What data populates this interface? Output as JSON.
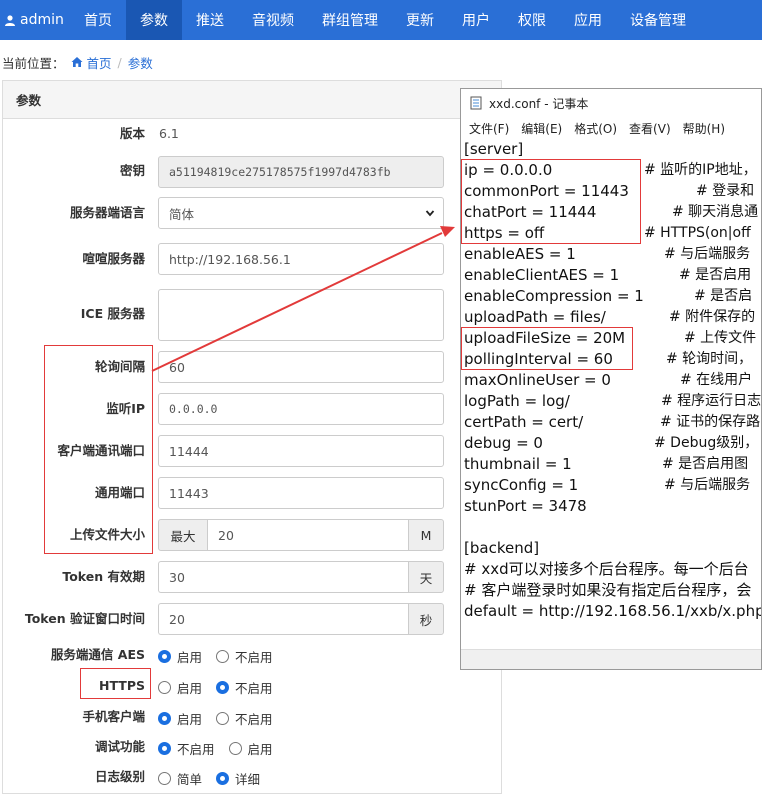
{
  "nav": {
    "brand": "admin",
    "items": [
      "首页",
      "参数",
      "推送",
      "音视频",
      "群组管理",
      "更新",
      "用户",
      "权限",
      "应用",
      "设备管理"
    ]
  },
  "breadcrumb": {
    "prefix": "当前位置：",
    "home": "首页",
    "sep": "/",
    "current": "参数"
  },
  "panel": {
    "title": "参数",
    "version_label": "版本",
    "version_value": "6.1",
    "key_label": "密钥",
    "key_value": "a51194819ce275178575f1997d4783fb",
    "lang_label": "服务器端语言",
    "lang_value": "简体",
    "xuan_label": "喧喧服务器",
    "xuan_value": "http://192.168.56.1",
    "ice_label": "ICE 服务器",
    "ice_value": "",
    "poll_label": "轮询间隔",
    "poll_value": "60",
    "listen_label": "监听IP",
    "listen_value": "0.0.0.0",
    "client_port_label": "客户端通讯端口",
    "client_port_value": "11444",
    "common_port_label": "通用端口",
    "common_port_value": "11443",
    "upload_label": "上传文件大小",
    "upload_prefix": "最大",
    "upload_value": "20",
    "upload_unit": "M",
    "token_label": "Token 有效期",
    "token_value": "30",
    "token_unit": "天",
    "tokenwin_label": "Token 验证窗口时间",
    "tokenwin_value": "20",
    "tokenwin_unit": "秒",
    "aes_label": "服务端通信 AES",
    "aes_on": "启用",
    "aes_off": "不启用",
    "https_label": "HTTPS",
    "https_on": "启用",
    "https_off": "不启用",
    "mobile_label": "手机客户端",
    "mobile_on": "启用",
    "mobile_off": "不启用",
    "debug_label": "调试功能",
    "debug_off": "不启用",
    "debug_on": "启用",
    "log_label": "日志级别",
    "log_simple": "简单",
    "log_detail": "详细"
  },
  "notepad": {
    "title": "xxd.conf - 记事本",
    "menu": [
      "文件(F)",
      "编辑(E)",
      "格式(O)",
      "查看(V)",
      "帮助(H)"
    ],
    "lines": [
      "[server]",
      "ip = 0.0.0.0",
      "commonPort = 11443",
      "chatPort = 11444",
      "https = off",
      "enableAES = 1",
      "enableClientAES = 1",
      "enableCompression = 1",
      "uploadPath = files/",
      "uploadFileSize = 20M",
      "pollingInterval = 60",
      "maxOnlineUser = 0",
      "logPath = log/",
      "certPath = cert/",
      "debug = 0",
      "thumbnail = 1",
      "syncConfig = 1",
      "stunPort = 3478",
      "",
      "[backend]",
      "# xxd可以对接多个后台程序。每一个后台",
      "# 客户端登录时如果没有指定后台程序，会",
      "default = http://192.168.56.1/xxb/x.php"
    ],
    "comments": [
      "",
      "# 监听的IP地址，",
      "# 登录和",
      "# 聊天消息通",
      "# HTTPS(on|off",
      "# 与后端服务",
      "# 是否启用",
      "# 是否启",
      "# 附件保存的",
      "# 上传文件",
      "# 轮询时间，",
      "# 在线用户",
      "# 程序运行日志",
      "# 证书的保存路",
      "# Debug级别，",
      "# 是否启用图",
      "# 与后端服务",
      "",
      "",
      "",
      "",
      "",
      ""
    ]
  },
  "colors": {
    "nav": "#2a6fd6",
    "nav_active": "#1a57b3",
    "highlight": "#e23a3a",
    "radio": "#1a6fe0"
  }
}
